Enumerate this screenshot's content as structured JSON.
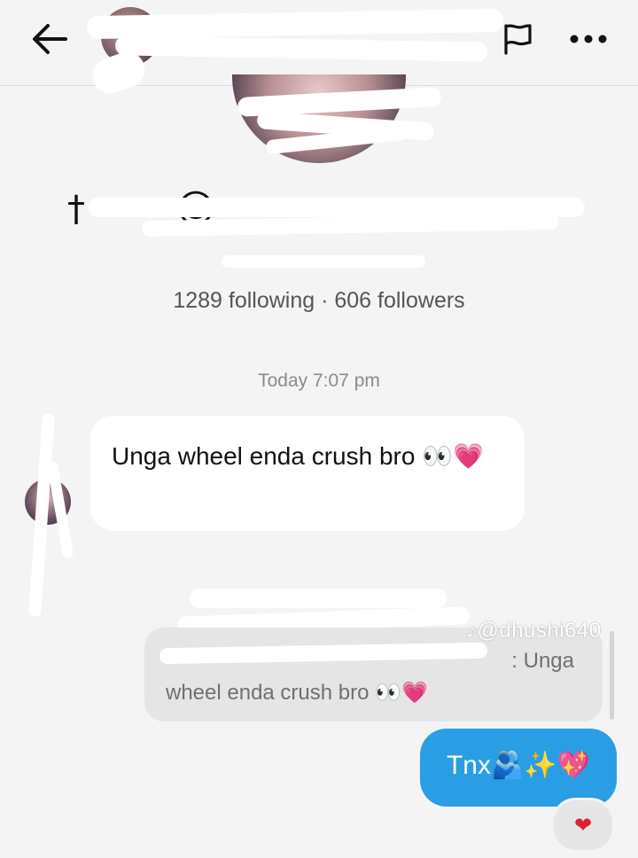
{
  "header": {
    "back_icon": "arrow-left-icon",
    "flag_icon": "flag-icon",
    "more_icon": "more-horizontal-icon"
  },
  "profile": {
    "stats": "1289 following · 606 followers"
  },
  "chat": {
    "timestamp": "Today 7:07 pm",
    "incoming_message": "Unga wheel enda crush bro 👀💗",
    "reply_preview": {
      "first_line": ": Unga",
      "second_line": "wheel enda crush bro 👀💗"
    },
    "watermark": "♪@dhushi640",
    "outgoing_message": "Tnx🫂✨💖",
    "reaction": "❤"
  },
  "colors": {
    "outgoing_bubble": "#2a9ee5",
    "incoming_bubble": "#ffffff",
    "background": "#f4f4f4",
    "reply_bubble": "#e5e5e5"
  }
}
